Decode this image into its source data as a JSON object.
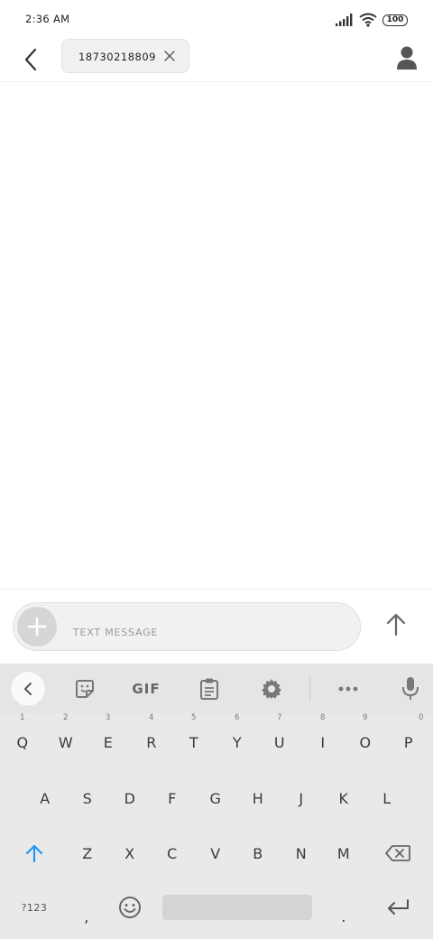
{
  "status_bar": {
    "time": "2:36 AM",
    "battery": "100"
  },
  "header": {
    "recipient": "18730218809"
  },
  "compose": {
    "placeholder": "TEXT MESSAGE"
  },
  "keyboard": {
    "toolbar": {
      "gif_label": "GIF"
    },
    "row1": [
      {
        "label": "Q",
        "num": "1"
      },
      {
        "label": "W",
        "num": "2"
      },
      {
        "label": "E",
        "num": "3"
      },
      {
        "label": "R",
        "num": "4"
      },
      {
        "label": "T",
        "num": "5"
      },
      {
        "label": "Y",
        "num": "6"
      },
      {
        "label": "U",
        "num": "7"
      },
      {
        "label": "I",
        "num": "8"
      },
      {
        "label": "O",
        "num": "9"
      },
      {
        "label": "P",
        "num": "0"
      }
    ],
    "row2": [
      "A",
      "S",
      "D",
      "F",
      "G",
      "H",
      "J",
      "K",
      "L"
    ],
    "row3": [
      "Z",
      "X",
      "C",
      "V",
      "B",
      "N",
      "M"
    ],
    "symbols_label": "?123",
    "comma": ",",
    "period": ".",
    "shift_color": "#2196F3"
  }
}
